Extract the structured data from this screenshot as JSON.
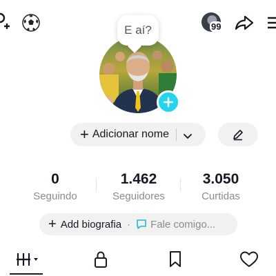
{
  "header": {
    "icons": [
      "add-user-icon",
      "soccer-ball-icon",
      "share-icon",
      "menu-icon"
    ],
    "friends_count": "99"
  },
  "profile": {
    "bubble_text": "E aí?",
    "add_name_label": "Adicionar nome"
  },
  "stats": [
    {
      "value": "0",
      "label": "Seguindo"
    },
    {
      "value": "1.462",
      "label": "Seguidores"
    },
    {
      "value": "3.050",
      "label": "Curtidas"
    }
  ],
  "bio": {
    "add_label": "Add biografia",
    "separator": "·",
    "hint": "Fale comigo..."
  },
  "tabs": [
    "videos-grid-icon",
    "lock-icon",
    "bookmark-icon",
    "heart-icon"
  ],
  "colors": {
    "accent": "#20d5ec",
    "text": "#161823",
    "muted": "#8a8b91",
    "pill": "#f1f1f2"
  }
}
